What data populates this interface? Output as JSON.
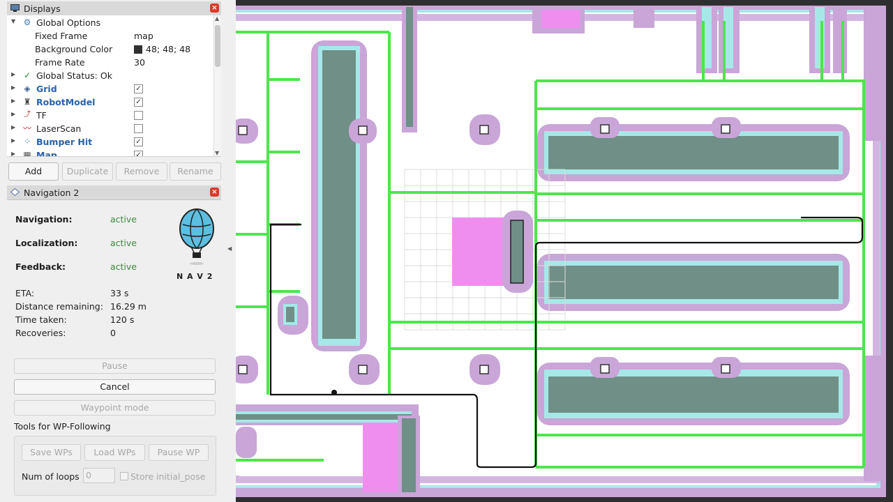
{
  "displays_panel": {
    "title": "Displays",
    "items": [
      {
        "name": "Global Options",
        "icon": "gear-icon",
        "expanded": true,
        "bold": false
      },
      {
        "name": "Fixed Frame",
        "value": "map",
        "child": true
      },
      {
        "name": "Background Color",
        "value": "48; 48; 48",
        "child": true,
        "swatch": "#303030"
      },
      {
        "name": "Frame Rate",
        "value": "30",
        "child": true
      },
      {
        "name": "Global Status: Ok",
        "icon": "check-icon",
        "bold": false
      },
      {
        "name": "Grid",
        "icon": "grid-icon",
        "bold": true,
        "checked": true
      },
      {
        "name": "RobotModel",
        "icon": "robot-icon",
        "bold": true,
        "checked": true
      },
      {
        "name": "TF",
        "icon": "tf-icon",
        "bold": false,
        "checked": false
      },
      {
        "name": "LaserScan",
        "icon": "laser-icon",
        "bold": false,
        "checked": false
      },
      {
        "name": "Bumper Hit",
        "icon": "bumper-icon",
        "bold": true,
        "checked": true
      },
      {
        "name": "Map",
        "icon": "map-icon",
        "bold": true,
        "checked": true
      }
    ],
    "buttons": {
      "add": "Add",
      "duplicate": "Duplicate",
      "remove": "Remove",
      "rename": "Rename"
    }
  },
  "nav_panel": {
    "title": "Navigation 2",
    "status": [
      {
        "label": "Navigation:",
        "value": "active"
      },
      {
        "label": "Localization:",
        "value": "active"
      },
      {
        "label": "Feedback:",
        "value": "active"
      }
    ],
    "logo_text": "N A V 2",
    "metrics": [
      {
        "label": "ETA:",
        "value": "33 s"
      },
      {
        "label": "Distance remaining:",
        "value": "16.29 m"
      },
      {
        "label": "Time taken:",
        "value": "120 s"
      },
      {
        "label": "Recoveries:",
        "value": "0"
      }
    ],
    "buttons": {
      "pause": "Pause",
      "cancel": "Cancel",
      "waypoint": "Waypoint mode"
    },
    "wp_title": "Tools for WP-Following",
    "wp_buttons": {
      "save": "Save WPs",
      "load": "Load WPs",
      "pause": "Pause WP"
    },
    "loops_label": "Num of loops",
    "loops_value": "0",
    "store_label": "Store initial_pose"
  },
  "colors": {
    "background": "#303030",
    "inflation": "#c9a5d8",
    "obstacle": "#6f8f87",
    "path": "#36e636",
    "robot": "#f08ef0",
    "status_active": "#3a8a3a"
  }
}
